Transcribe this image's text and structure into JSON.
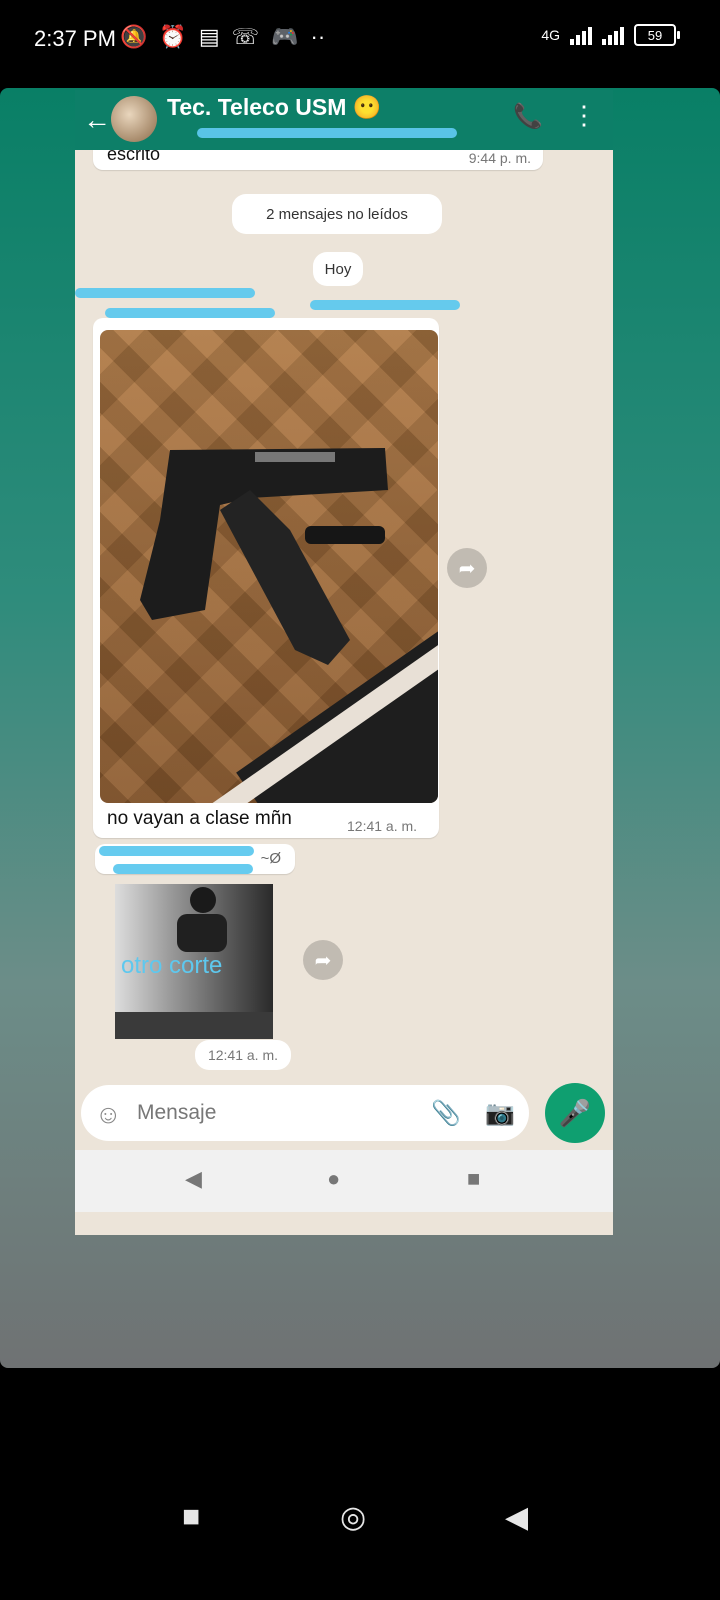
{
  "status_bar": {
    "time": "2:37 PM",
    "network": "4G",
    "battery": "59",
    "icons": [
      "mute-icon",
      "alarm-icon",
      "notification-icon",
      "call-icon",
      "game-icon"
    ],
    "more": "··"
  },
  "chat_header": {
    "back_icon": "arrow-left-icon",
    "title": "Tec. Teleco USM 😶",
    "add_call_icon": "phone-plus-icon",
    "more_icon": "more-vert-icon"
  },
  "messages": {
    "prev_fragment": "escrito",
    "prev_time": "9:44 p. m.",
    "unread_banner": "2 mensajes no leídos",
    "date_label": "Hoy",
    "image_caption": "no vayan a clase mñn",
    "image_time": "12:41 a. m.",
    "sender2_suffix": "~Ø",
    "photo2_caption": "otro corte",
    "photo2_time": "12:41 a. m."
  },
  "composer": {
    "placeholder": "Mensaje",
    "emoji_icon": "emoji-icon",
    "attach_icon": "paperclip-icon",
    "camera_icon": "camera-icon",
    "mic_icon": "mic-icon"
  },
  "colors": {
    "header_green": "#0d7f68",
    "mic_green": "#0f9f70",
    "chat_bg": "#ece4d9",
    "scribble_blue": "#5ec8ee"
  }
}
